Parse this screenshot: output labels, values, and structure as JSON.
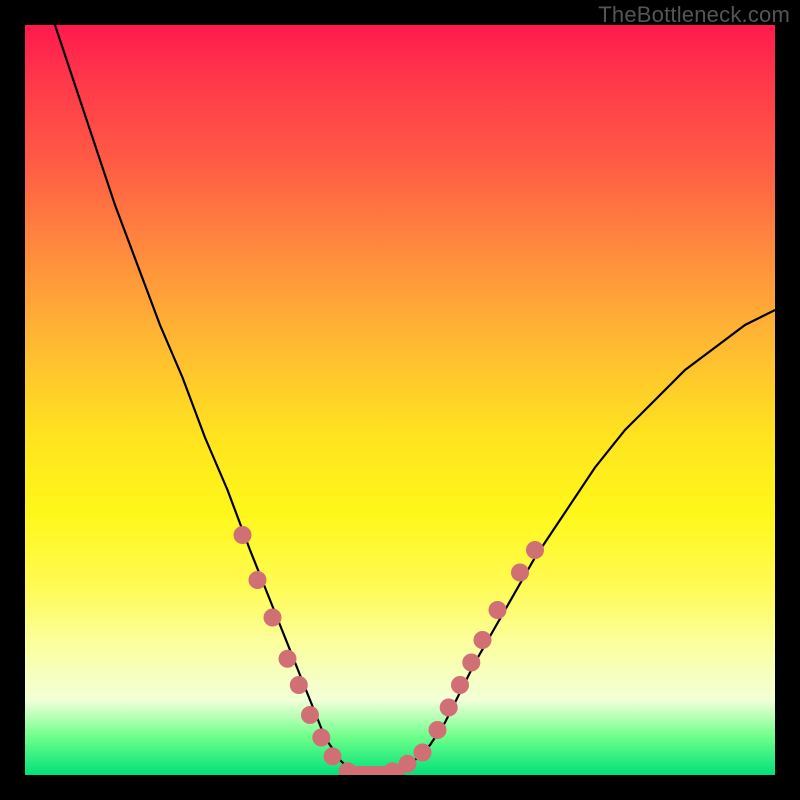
{
  "watermark": "TheBottleneck.com",
  "chart_data": {
    "type": "line",
    "title": "",
    "xlabel": "",
    "ylabel": "",
    "xlim": [
      0,
      100
    ],
    "ylim": [
      0,
      100
    ],
    "series": [
      {
        "name": "bottleneck-curve",
        "x": [
          4,
          6,
          9,
          12,
          15,
          18,
          21,
          24,
          27,
          30,
          32,
          34,
          36,
          38,
          40,
          42,
          43,
          44,
          45,
          46,
          48,
          50,
          52,
          54,
          56,
          58,
          60,
          64,
          68,
          72,
          76,
          80,
          84,
          88,
          92,
          96,
          100
        ],
        "y": [
          100,
          94,
          85,
          76,
          68,
          60,
          53,
          45,
          38,
          30,
          25,
          20,
          15,
          10,
          5,
          2,
          1,
          0,
          0,
          0,
          0,
          1,
          2,
          4,
          7,
          11,
          15,
          22,
          29,
          35,
          41,
          46,
          50,
          54,
          57,
          60,
          62
        ]
      }
    ],
    "markers": {
      "name": "highlighted-points",
      "color": "#d07075",
      "points": [
        {
          "x": 29,
          "y": 32
        },
        {
          "x": 31,
          "y": 26
        },
        {
          "x": 33,
          "y": 21
        },
        {
          "x": 35,
          "y": 15.5
        },
        {
          "x": 36.5,
          "y": 12
        },
        {
          "x": 38,
          "y": 8
        },
        {
          "x": 39.5,
          "y": 5
        },
        {
          "x": 41,
          "y": 2.5
        },
        {
          "x": 43,
          "y": 0.5
        },
        {
          "x": 45,
          "y": 0
        },
        {
          "x": 47,
          "y": 0
        },
        {
          "x": 49,
          "y": 0.5
        },
        {
          "x": 51,
          "y": 1.5
        },
        {
          "x": 53,
          "y": 3
        },
        {
          "x": 55,
          "y": 6
        },
        {
          "x": 56.5,
          "y": 9
        },
        {
          "x": 58,
          "y": 12
        },
        {
          "x": 59.5,
          "y": 15
        },
        {
          "x": 61,
          "y": 18
        },
        {
          "x": 63,
          "y": 22
        },
        {
          "x": 66,
          "y": 27
        },
        {
          "x": 68,
          "y": 30
        }
      ]
    },
    "gradient_stops": [
      {
        "pos": 0,
        "color": "#ff1a4d"
      },
      {
        "pos": 50,
        "color": "#ffe41f"
      },
      {
        "pos": 100,
        "color": "#00e079"
      }
    ]
  }
}
